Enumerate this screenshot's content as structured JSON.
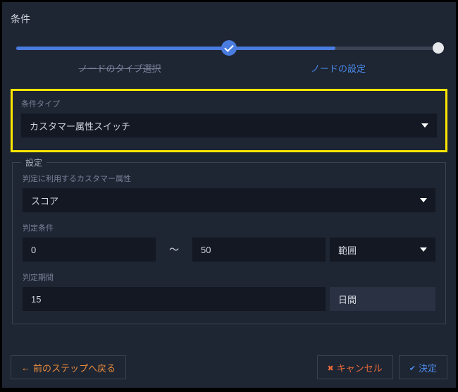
{
  "header": {
    "title": "条件"
  },
  "steps": {
    "done": "ノードのタイプ選択",
    "active": "ノードの設定"
  },
  "conditionType": {
    "label": "条件タイプ",
    "value": "カスタマー属性スイッチ"
  },
  "settings": {
    "legend": "設定",
    "attribute": {
      "label": "判定に利用するカスタマー属性",
      "value": "スコア"
    },
    "condition": {
      "label": "判定条件",
      "from": "0",
      "separator": "〜",
      "to": "50",
      "mode": "範囲"
    },
    "period": {
      "label": "判定期間",
      "value": "15",
      "unit": "日間"
    }
  },
  "footer": {
    "back": "前のステップへ戻る",
    "cancel": "キャンセル",
    "confirm": "決定"
  }
}
